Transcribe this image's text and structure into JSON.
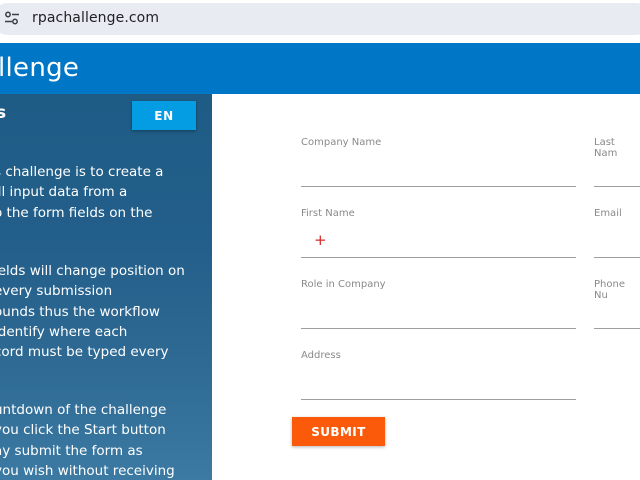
{
  "browser": {
    "url": "rpachallenge.com",
    "site_info_icon": "tune-icon"
  },
  "header": {
    "title": "llenge"
  },
  "sidebar": {
    "heading": "s",
    "language_button": "EN",
    "paragraphs": [
      [
        "s challenge is to create a",
        "ill input data from a",
        "o the form fields on the"
      ],
      [
        "ields will change position on",
        " every submission",
        "ounds thus the workflow",
        "identify where each",
        "cord must be typed every"
      ],
      [
        "untdown of the challenge",
        "you click the Start button",
        "ay submit the form as",
        "you wish without receiving"
      ]
    ]
  },
  "form": {
    "labels": {
      "company_name": "Company Name",
      "last_name": "Last Nam",
      "first_name": "First Name",
      "email": "Email",
      "role_in_company": "Role in Company",
      "phone_number": "Phone Nu",
      "address": "Address"
    },
    "values": {
      "company_name": "",
      "last_name": "",
      "first_name": "",
      "email": "",
      "role_in_company": "",
      "phone_number": "",
      "address": ""
    },
    "cursor_glyph": "+",
    "submit_label": "SUBMIT"
  },
  "colors": {
    "header_bg": "#0076c6",
    "sidebar_bg": "#235f8a",
    "lang_button_bg": "#049ce2",
    "submit_bg": "#fa5a0a"
  }
}
